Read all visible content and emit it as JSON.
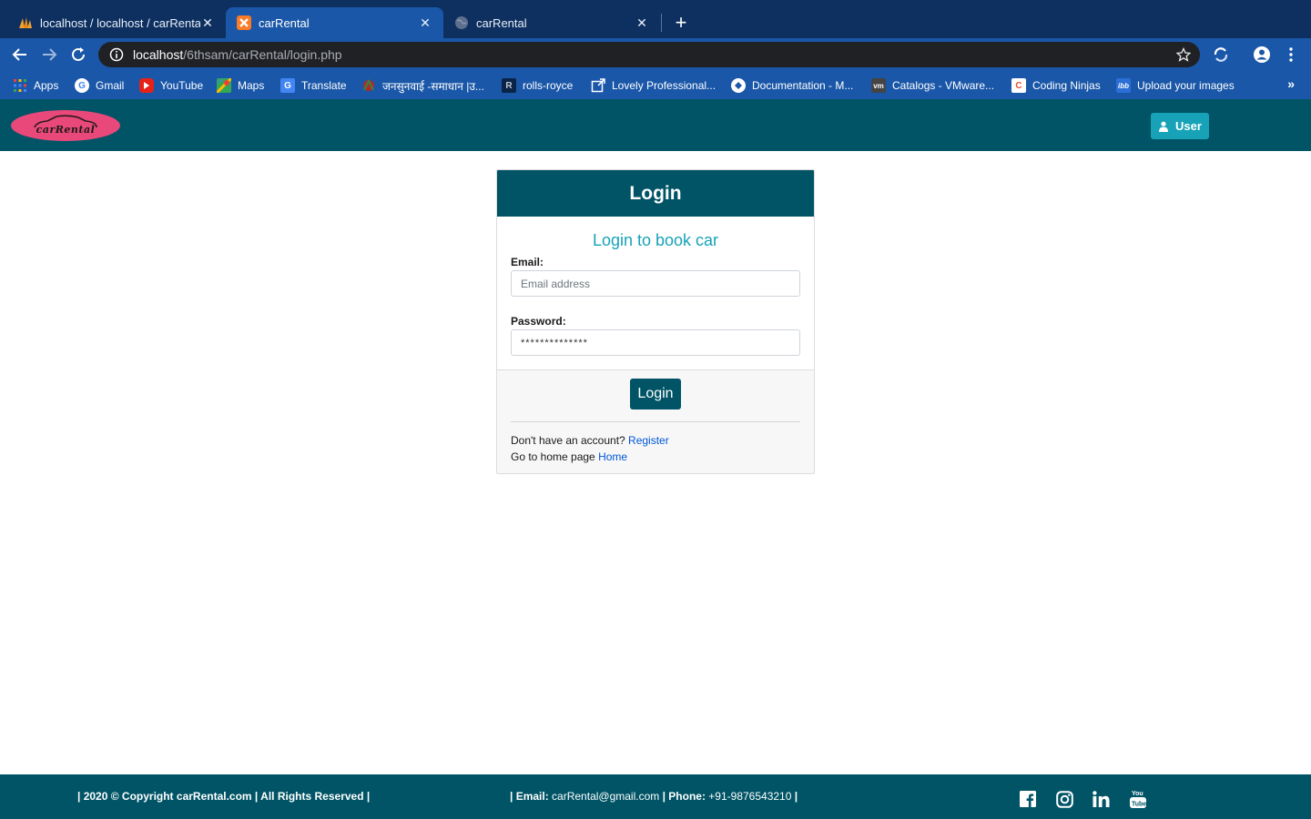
{
  "browser": {
    "tabs": [
      {
        "title": "localhost / localhost / carRental / ",
        "icon": "phpmyadmin-icon"
      },
      {
        "title": "carRental",
        "icon": "xampp-icon",
        "active": true
      },
      {
        "title": "carRental",
        "icon": "globe-icon"
      }
    ],
    "url": {
      "host": "localhost",
      "path": "/6thsam/carRental/login.php"
    },
    "bookmarks": [
      {
        "label": "Apps",
        "icon": "apps-grid-icon"
      },
      {
        "label": "Gmail",
        "icon": "google-icon"
      },
      {
        "label": "YouTube",
        "icon": "youtube-icon"
      },
      {
        "label": "Maps",
        "icon": "maps-icon"
      },
      {
        "label": "Translate",
        "icon": "translate-icon"
      },
      {
        "label": "जनसुनवाई -समाधान |उ...",
        "icon": "emblem-icon"
      },
      {
        "label": "rolls-royce",
        "icon": "rolls-royce-icon"
      },
      {
        "label": "Lovely Professional...",
        "icon": "external-link-icon"
      },
      {
        "label": "Documentation - M...",
        "icon": "docs-icon"
      },
      {
        "label": "Catalogs - VMware...",
        "icon": "vmware-icon"
      },
      {
        "label": "Coding Ninjas",
        "icon": "coding-ninjas-icon"
      },
      {
        "label": "Upload your images",
        "icon": "ibb-icon"
      }
    ],
    "more_bookmarks": "»"
  },
  "navbar": {
    "logo_text": "carRental",
    "user_button": "User"
  },
  "login": {
    "header": "Login",
    "subtitle": "Login to book car",
    "email_label": "Email:",
    "email_placeholder": "Email address",
    "password_label": "Password:",
    "password_value": "**************",
    "submit": "Login",
    "no_account_text": "Don't have an account? ",
    "register_link": "Register",
    "home_text": "Go to home page ",
    "home_link": "Home"
  },
  "footer": {
    "copyright": "| 2020 © Copyright carRental.com | All Rights Reserved |",
    "email_label": "| Email: ",
    "email_value": "carRental@gmail.com",
    "phone_label": " | Phone: ",
    "phone_value": "+91-9876543210",
    "end": " |",
    "social": [
      "facebook-icon",
      "instagram-icon",
      "linkedin-icon",
      "youtube-icon"
    ]
  },
  "colors": {
    "chrome_tabbar": "#0e3060",
    "chrome_toolbar": "#1a57a8",
    "site_primary": "#005466",
    "accent": "#17a2b8",
    "logo_bg": "#e8487a"
  }
}
